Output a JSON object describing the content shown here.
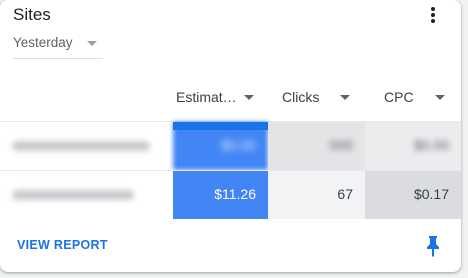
{
  "card": {
    "title": "Sites",
    "more_icon": "more-vert-icon"
  },
  "date_filter": {
    "selected": "Yesterday"
  },
  "table": {
    "columns": [
      {
        "label": "Estimat…",
        "sort_icon": "sort-caret-icon"
      },
      {
        "label": "Clicks",
        "sort_icon": "sort-caret-icon"
      },
      {
        "label": "CPC",
        "sort_icon": "sort-caret-icon"
      }
    ],
    "rows": [
      {
        "site": "",
        "estimated": "$0.00",
        "clicks": "000",
        "cpc": "$0.00",
        "blurred": true
      },
      {
        "site": "",
        "estimated": "$11.26",
        "clicks": "67",
        "cpc": "$0.17",
        "blurred": true
      }
    ]
  },
  "footer": {
    "view_report": "VIEW REPORT",
    "pin_icon": "pin-icon"
  },
  "colors": {
    "accent": "#1a73e8",
    "heat_high": "#4285f4",
    "heat_mid": "#dadce0",
    "heat_low": "#f1f3f4"
  }
}
